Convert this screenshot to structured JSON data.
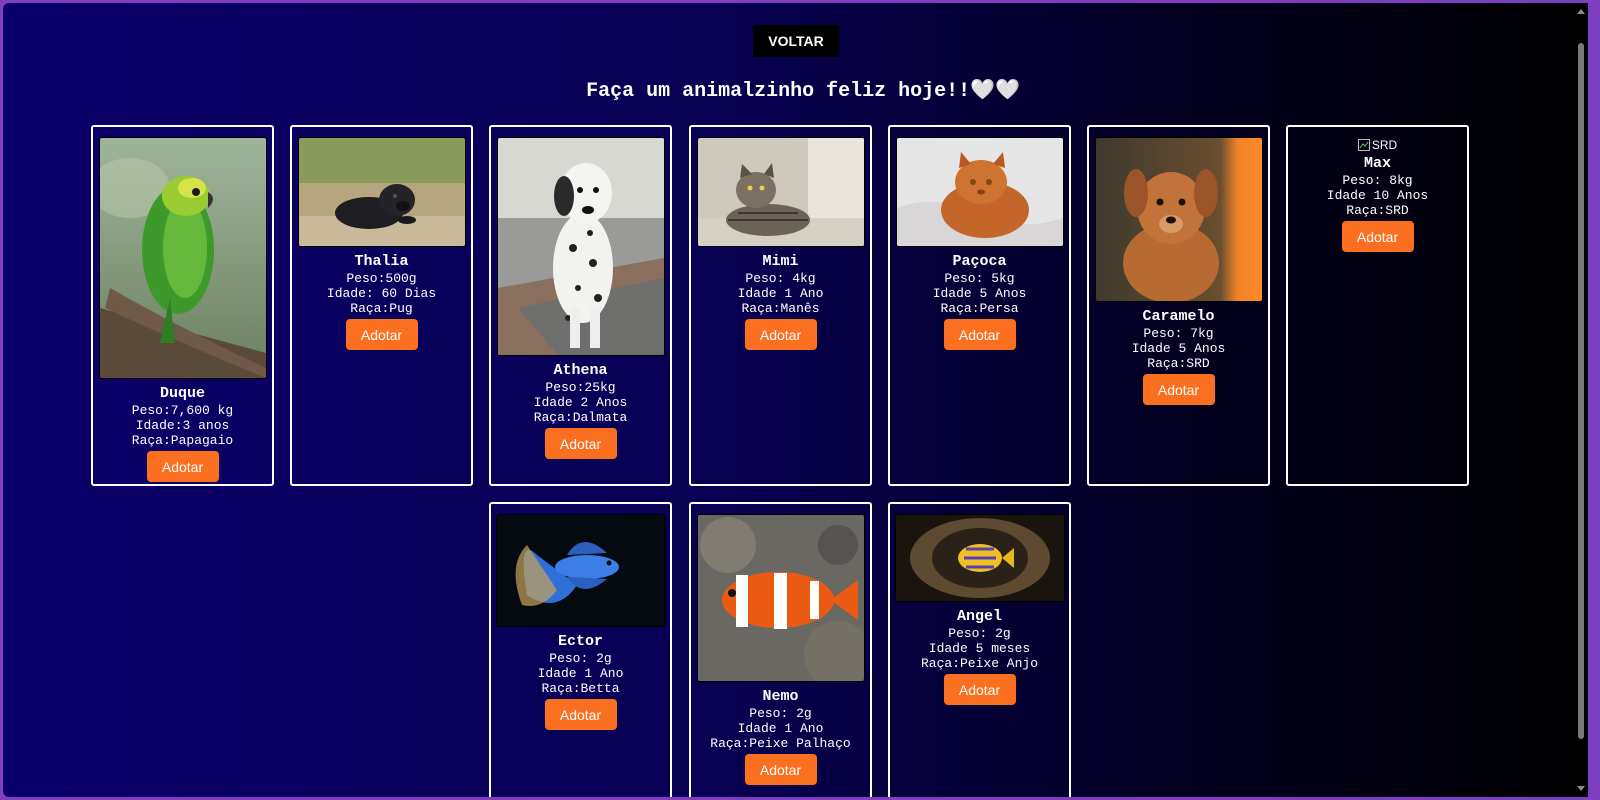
{
  "back_label": "VOLTAR",
  "headline": "Faça um animalzinho feliz hoje!!🤍🤍",
  "pets": [
    {
      "name": "Duque",
      "peso": "Peso:7,600 kg",
      "idade": "Idade:3 anos",
      "raca": "Raça:Papagaio",
      "adopt": "Adotar",
      "icon": "parrot-photo"
    },
    {
      "name": "Thalia",
      "peso": "Peso:500g",
      "idade": "Idade: 60 Dias",
      "raca": "Raça:Pug",
      "adopt": "Adotar",
      "icon": "pug-photo"
    },
    {
      "name": "Athena",
      "peso": "Peso:25kg",
      "idade": "Idade 2 Anos",
      "raca": "Raça:Dalmata",
      "adopt": "Adotar",
      "icon": "dalmatian-photo"
    },
    {
      "name": "Mimi",
      "peso": "Peso: 4kg",
      "idade": "Idade 1 Ano",
      "raca": "Raça:Manês",
      "adopt": "Adotar",
      "icon": "tabby-cat-photo"
    },
    {
      "name": "Paçoca",
      "peso": "Peso: 5kg",
      "idade": "Idade 5 Anos",
      "raca": "Raça:Persa",
      "adopt": "Adotar",
      "icon": "persian-cat-photo"
    },
    {
      "name": "Caramelo",
      "peso": "Peso: 7kg",
      "idade": "Idade 5 Anos",
      "raca": "Raça:SRD",
      "adopt": "Adotar",
      "icon": "caramel-dog-photo"
    },
    {
      "name": "Max",
      "peso": "Peso: 8kg",
      "idade": "Idade 10 Anos",
      "raca": "Raça:SRD",
      "adopt": "Adotar",
      "icon": "broken-image-icon",
      "alt": "SRD"
    },
    {
      "name": "Ector",
      "peso": "Peso: 2g",
      "idade": "Idade 1 Ano",
      "raca": "Raça:Betta",
      "adopt": "Adotar",
      "icon": "betta-fish-photo"
    },
    {
      "name": "Nemo",
      "peso": "Peso: 2g",
      "idade": "Idade 1 Ano",
      "raca": "Raça:Peixe Palhaço",
      "adopt": "Adotar",
      "icon": "clownfish-photo"
    },
    {
      "name": "Angel",
      "peso": "Peso: 2g",
      "idade": "Idade 5 meses",
      "raca": "Raça:Peixe Anjo",
      "adopt": "Adotar",
      "icon": "angelfish-photo"
    }
  ]
}
